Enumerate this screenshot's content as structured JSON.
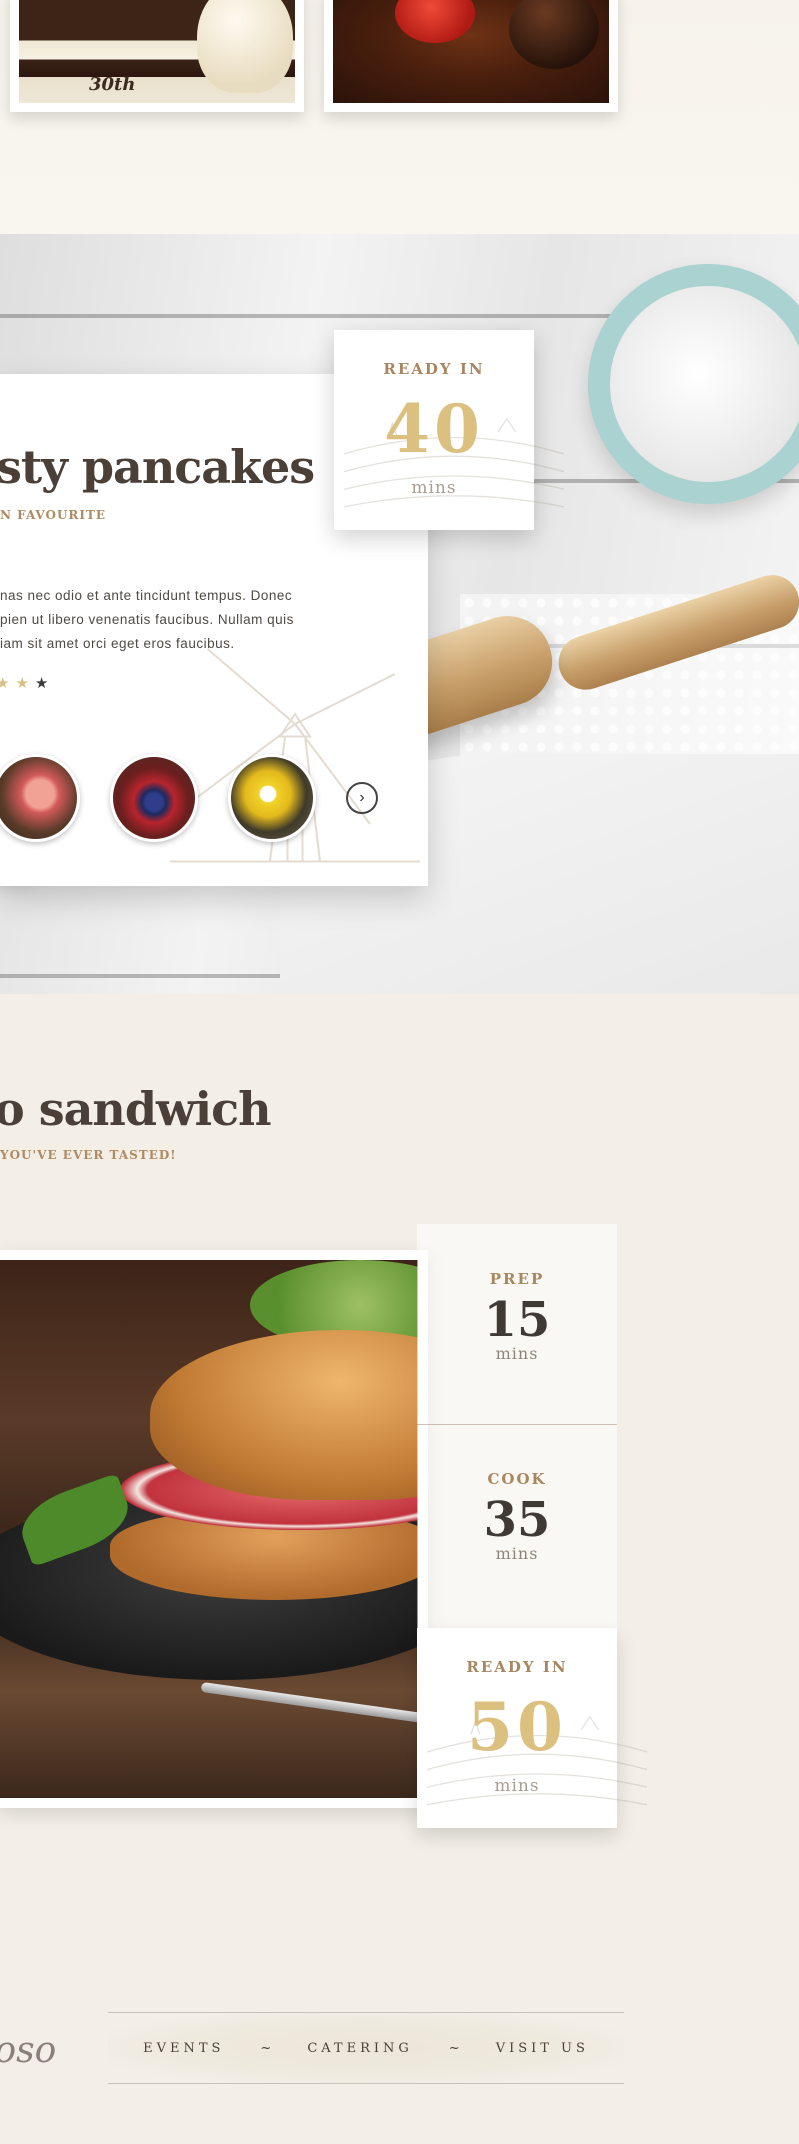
{
  "top": {
    "cake_label": "30th"
  },
  "pancakes": {
    "title": "sty pancakes",
    "subtitle": "N FAVOURITE",
    "description": "nas nec odio et ante tincidunt tempus. Donec\npien ut libero venenatis faucibus. Nullam quis\niam sit amet orci eget eros faucibus.",
    "rating": {
      "filled": 2,
      "empty": 1,
      "star_char": "★"
    },
    "ready": {
      "label": "READY IN",
      "value": "40",
      "unit": "mins"
    },
    "next_arrow": "›",
    "ingredients": [
      "ham",
      "berries",
      "pepper"
    ]
  },
  "sandwich": {
    "title": "o sandwich",
    "subtitle": "YOU'VE EVER TASTED!",
    "prep": {
      "label": "PREP",
      "value": "15",
      "unit": "mins"
    },
    "cook": {
      "label": "COOK",
      "value": "35",
      "unit": "mins"
    },
    "ready": {
      "label": "READY IN",
      "value": "50",
      "unit": "mins"
    }
  },
  "footer": {
    "logo": "toso",
    "nav": [
      {
        "label": "EVENTS"
      },
      {
        "label": "CATERING"
      },
      {
        "label": "VISIT US"
      }
    ],
    "separator": "~"
  },
  "colors": {
    "accent_gold": "#dcc07f",
    "label_brown": "#a98660",
    "heading_dark": "#4a4038",
    "background": "#f3efe7"
  }
}
